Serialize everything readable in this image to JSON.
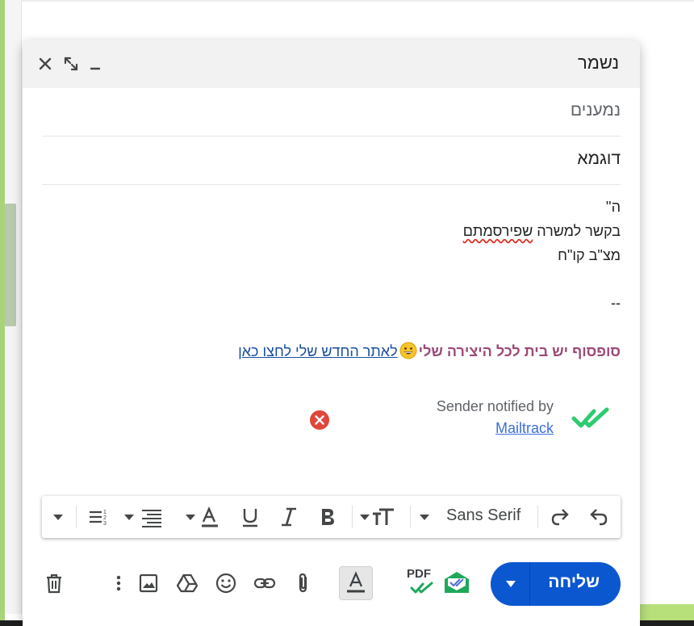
{
  "compose": {
    "title": "נשמר",
    "recipients_placeholder": "נמענים",
    "subject": "דוגמא",
    "body": {
      "line1": "ה''",
      "line2_before": "בקשר למשרה ",
      "line2_misspelled": "שפירסמתם",
      "line3": "מצ\"ב קו\"ח",
      "sig_separator": "--"
    },
    "signature": {
      "text": "סופסוף יש בית לכל היצירה שלי",
      "emoji": "grinning-face-emoji",
      "link": "לאתר החדש שלי לחצו כאן"
    },
    "mailtrack": {
      "notified": "Sender notified by",
      "link": "Mailtrack"
    }
  },
  "toolbar": {
    "font": "Sans Serif"
  },
  "actions": {
    "send": "שליחה",
    "pdf_label": "PDF"
  },
  "colors": {
    "send_button": "#0b57d0",
    "signature_text": "#9c4a78",
    "link": "#1a4fa0",
    "mailtrack_check": "#2ecc71",
    "close_red": "#e0463b"
  }
}
